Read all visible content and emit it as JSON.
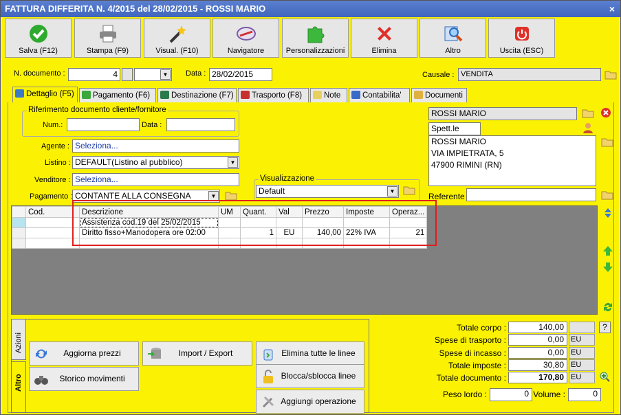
{
  "window": {
    "title": "FATTURA DIFFERITA N. 4/2015 del 28/02/2015 - ROSSI MARIO",
    "close": "×"
  },
  "toolbar": [
    {
      "label": "Salva (F12)",
      "icon": "check-icon",
      "color": "#2eaa2e"
    },
    {
      "label": "Stampa (F9)",
      "icon": "printer-icon",
      "color": "#888888"
    },
    {
      "label": "Visual. (F10)",
      "icon": "magic-wand-icon",
      "color": "#333333"
    },
    {
      "label": "Navigatore",
      "icon": "compass-icon",
      "color": "#7a5aa8"
    },
    {
      "label": "Personalizzazioni",
      "icon": "puzzle-icon",
      "color": "#3cb83c"
    },
    {
      "label": "Elimina",
      "icon": "delete-x-icon",
      "color": "#e0302a"
    },
    {
      "label": "Altro",
      "icon": "magnifier-icon",
      "color": "#2a6ac0"
    },
    {
      "label": "Uscita (ESC)",
      "icon": "power-icon",
      "color": "#e0302a"
    }
  ],
  "header": {
    "ndoc_label": "N. documento :",
    "ndoc_value": "4",
    "data_label": "Data :",
    "data_value": "28/02/2015",
    "causale_label": "Causale :",
    "causale_value": "VENDITA"
  },
  "tabs": [
    {
      "label": "Dettaglio (F5)",
      "active": true,
      "color": "#3a78c8"
    },
    {
      "label": "Pagamento (F6)",
      "color": "#3aa83a"
    },
    {
      "label": "Destinazione (F7)",
      "color": "#2a7a4a"
    },
    {
      "label": "Trasporto (F8)",
      "color": "#c83030"
    },
    {
      "label": "Note",
      "color": "#e8d060"
    },
    {
      "label": "Contabilita'",
      "color": "#3a6ac8"
    },
    {
      "label": "Documenti",
      "color": "#e0b040"
    }
  ],
  "rif": {
    "legend": "Riferimento documento cliente/fornitore",
    "num_label": "Num.:",
    "num_value": "",
    "data_label": "Data :",
    "data_value": ""
  },
  "agente": {
    "label": "Agente :",
    "value": "Seleziona..."
  },
  "listino": {
    "label": "Listino :",
    "value": "DEFAULT(Listino al pubblico)"
  },
  "venditore": {
    "label": "Venditore :",
    "value": "Seleziona..."
  },
  "pagamento": {
    "label": "Pagamento :",
    "value": "CONTANTE ALLA CONSEGNA"
  },
  "visualizzazione": {
    "legend": "Visualizzazione",
    "value": "Default"
  },
  "cliente": {
    "name": "ROSSI MARIO",
    "title": "Spett.le",
    "address": [
      "ROSSI MARIO",
      "VIA IMPIETRATA, 5",
      "47900 RIMINI (RN)"
    ],
    "referente_label": "Referente",
    "referente_value": ""
  },
  "grid": {
    "columns": [
      "Cod.",
      "Descrizione",
      "UM",
      "Quant.",
      "Val",
      "Prezzo",
      "Imposte",
      "Operaz..."
    ],
    "rows": [
      [
        "",
        "Assistenza cod.19 del 25/02/2015",
        "",
        "",
        "",
        "",
        "",
        ""
      ],
      [
        "",
        "Diritto fisso+Manodopera ore 02:00",
        "",
        "1",
        "EU",
        "140,00",
        "22% IVA",
        "21"
      ],
      [
        "",
        "",
        "",
        "",
        "",
        "",
        "",
        ""
      ]
    ]
  },
  "side_tabs": {
    "azioni": "Azioni",
    "altro": "Altro"
  },
  "actions": [
    {
      "label": "Aggiorna prezzi",
      "icon": "refresh-icon"
    },
    {
      "label": "Import / Export",
      "icon": "database-import-icon"
    },
    {
      "label": "Elimina tutte le linee",
      "icon": "recycle-bin-icon"
    },
    {
      "label": "Storico movimenti",
      "icon": "binoculars-icon"
    },
    {
      "label": "Blocca/sblocca linee",
      "icon": "padlock-icon"
    },
    {
      "label": "Aggiungi operazione",
      "icon": "tools-icon"
    }
  ],
  "totals": {
    "corpo": {
      "label": "Totale corpo :",
      "value": "140,00"
    },
    "trasporto": {
      "label": "Spese di trasporto :",
      "value": "0,00",
      "unit": "EU"
    },
    "incasso": {
      "label": "Spese di incasso :",
      "value": "0,00",
      "unit": "EU"
    },
    "imposte": {
      "label": "Totale imposte :",
      "value": "30,80",
      "unit": "EU"
    },
    "documento": {
      "label": "Totale documento :",
      "value": "170,80",
      "unit": "EU"
    },
    "help": "?"
  },
  "peso": {
    "label": "Peso lordo :",
    "value": "0"
  },
  "volume": {
    "label": "Volume :",
    "value": "0"
  }
}
